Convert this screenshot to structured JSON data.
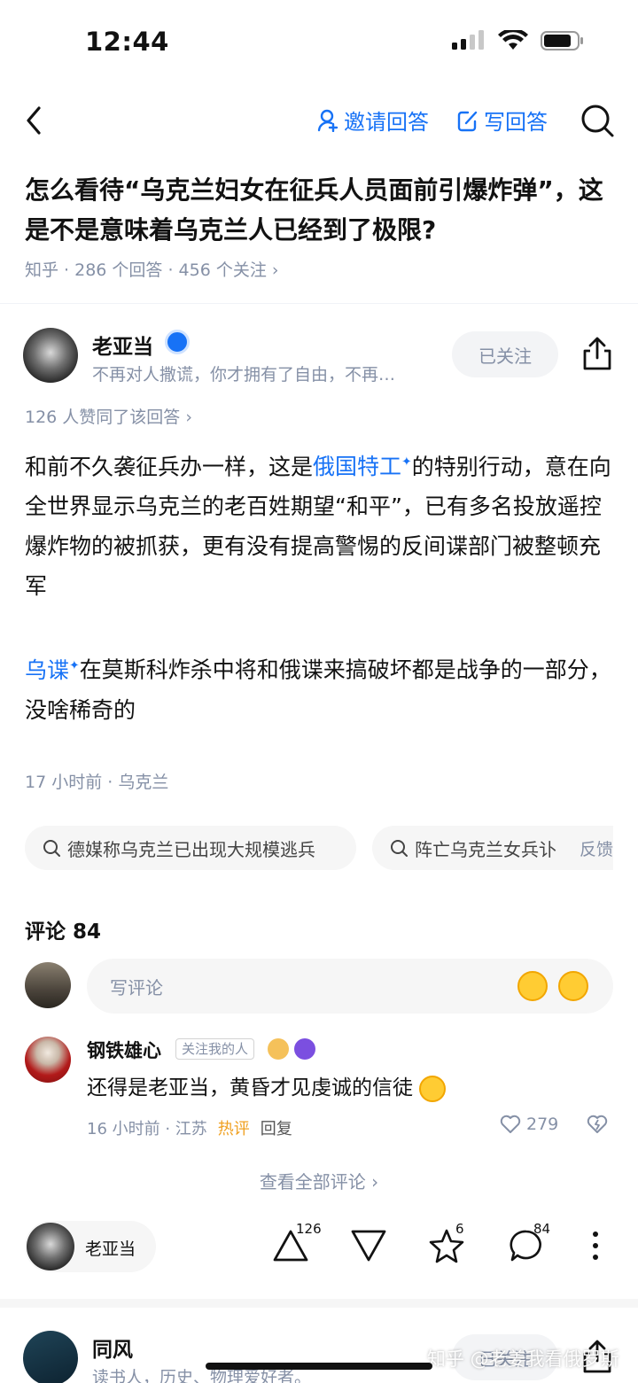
{
  "status": {
    "time": "12:44"
  },
  "nav": {
    "invite": "邀请回答",
    "write": "写回答"
  },
  "question": {
    "title": "怎么看待“乌克兰妇女在征兵人员面前引爆炸弹”，这是不是意味着乌克兰人已经到了极限?",
    "meta": "知乎 · 286 个回答 · 456 个关注 ›"
  },
  "author": {
    "name": "老亚当",
    "bio": "不再对人撒谎，你才拥有了自由，不再…",
    "follow": "已关注"
  },
  "answer": {
    "votes": "126 人赞同了该回答 ›",
    "p1_a": "和前不久袭征兵办一样，这是",
    "p1_link": "俄国特工",
    "p1_b": "的特别行动，意在向全世界显示乌克兰的老百姓期望“和平”，已有多名投放遥控爆炸物的被抓获，更有没有提高警惕的反间谍部门被整顿充军",
    "p2_link": "乌谍",
    "p2_b": "在莫斯科炸杀中将和俄谍来搞破坏都是战争的一部分，没啥稀奇的",
    "meta": "17 小时前 · 乌克兰"
  },
  "related": {
    "chip1": "德媒称乌克兰已出现大规模逃兵",
    "chip2": "阵亡乌克兰女兵讣",
    "feedback": "反馈"
  },
  "comments": {
    "title": "评论 84",
    "placeholder": "写评论",
    "item": {
      "name": "钢铁雄心",
      "tag": "关注我的人",
      "text": "还得是老亚当，黄昏才见虔诚的信徒",
      "time": "16 小时前 · 江苏",
      "hot": "热评",
      "reply": "回复",
      "likes": "279"
    },
    "view_all": "查看全部评论 ›"
  },
  "actions": {
    "author": "老亚当",
    "upvotes": "126",
    "favorites": "6",
    "comments": "84"
  },
  "next": {
    "name": "同风",
    "bio": "读书人，历史、物理爱好者。",
    "follow": "已关注"
  },
  "watermark": "知乎 @老姜我看俄罗斯"
}
